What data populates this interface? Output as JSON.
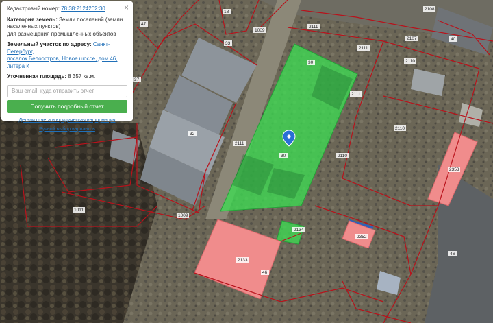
{
  "panel": {
    "cadastral_label": "Кадастровый номер:",
    "cadastral_value": "78:38:2124202:30",
    "category_label": "Категория земель:",
    "category_value_1": "Земли поселений (земли",
    "category_value_2": "населенных пунктов)",
    "category_value_3": "для размещения промышленных объектов",
    "address_label": "Земельный участок по адресу:",
    "address_link_1": "Санкт-Петербург,",
    "address_link_2": "поселок Белоостров, Новое шоссе, дом 46, литера К",
    "area_label": "Уточненная площадь:",
    "area_value": "8 357 кв.м.",
    "email_placeholder": "Ваш email, куда отправить отчет",
    "submit_label": "Получить подробный отчет",
    "details_link": "Детали отчета и юридическая информация",
    "manual_link": "Ручной выбор вариантов",
    "close_symbol": "×"
  },
  "map_labels": {
    "l_47": "47",
    "l_18": "18",
    "l_1009a": "1009",
    "l_2111a": "2111",
    "l_2108": "2108",
    "l_40": "40",
    "l_2107": "2107",
    "l_2111b": "2111",
    "l_2110a": "2110",
    "l_30a": "30",
    "l_2111c": "2111",
    "l_33": "33",
    "l_32": "32",
    "l_2111d": "2111",
    "l_30b": "30",
    "l_2110b": "2110",
    "l_2110c": "2110",
    "l_2353": "2353",
    "l_1011": "1011",
    "l_1009b": "1009",
    "l_2133": "2133",
    "l_46a": "46",
    "l_2134": "2134",
    "l_46b": "46",
    "l_2352": "2352",
    "l_37": "37"
  },
  "colors": {
    "selected_plot": "#3ddb52",
    "neighbor_plot": "#f08c8c",
    "boundary": "#b8121b",
    "pin": "#2a6fd6"
  }
}
